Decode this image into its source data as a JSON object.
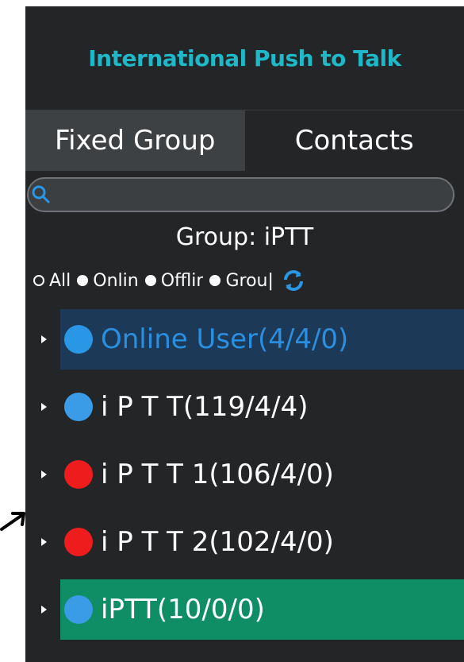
{
  "header": {
    "title": "International Push to Talk"
  },
  "tabs": [
    {
      "label": "Fixed Group",
      "active": true
    },
    {
      "label": "Contacts",
      "active": false
    }
  ],
  "search": {
    "value": "",
    "placeholder": ""
  },
  "group": {
    "label": "Group:  iPTT"
  },
  "filters": [
    {
      "label": "All",
      "selected": false
    },
    {
      "label": "Onlin",
      "selected": true
    },
    {
      "label": "Offlir",
      "selected": true
    },
    {
      "label": "Grou|",
      "selected": true
    }
  ],
  "tree": [
    {
      "label": "Online User(4/4/0)",
      "status_color": "#2a96e6",
      "state": "selected"
    },
    {
      "label": "i P T T(119/4/4)",
      "status_color": "#3a9be6",
      "state": "normal"
    },
    {
      "label": "i P T T 1(106/4/0)",
      "status_color": "#ee1c1c",
      "state": "normal"
    },
    {
      "label": "i P T T 2(102/4/0)",
      "status_color": "#ee1c1c",
      "state": "normal"
    },
    {
      "label": "iPTT(10/0/0)",
      "status_color": "#3a9be6",
      "state": "highlighted"
    }
  ],
  "colors": {
    "background": "#232527",
    "title": "#1fb8c8",
    "selected_row": "#1c3a57",
    "highlighted_row": "#0f8d64"
  },
  "icons": [
    "search-icon",
    "refresh-icon",
    "expand-arrow-icon",
    "pointer-arrow-icon"
  ]
}
